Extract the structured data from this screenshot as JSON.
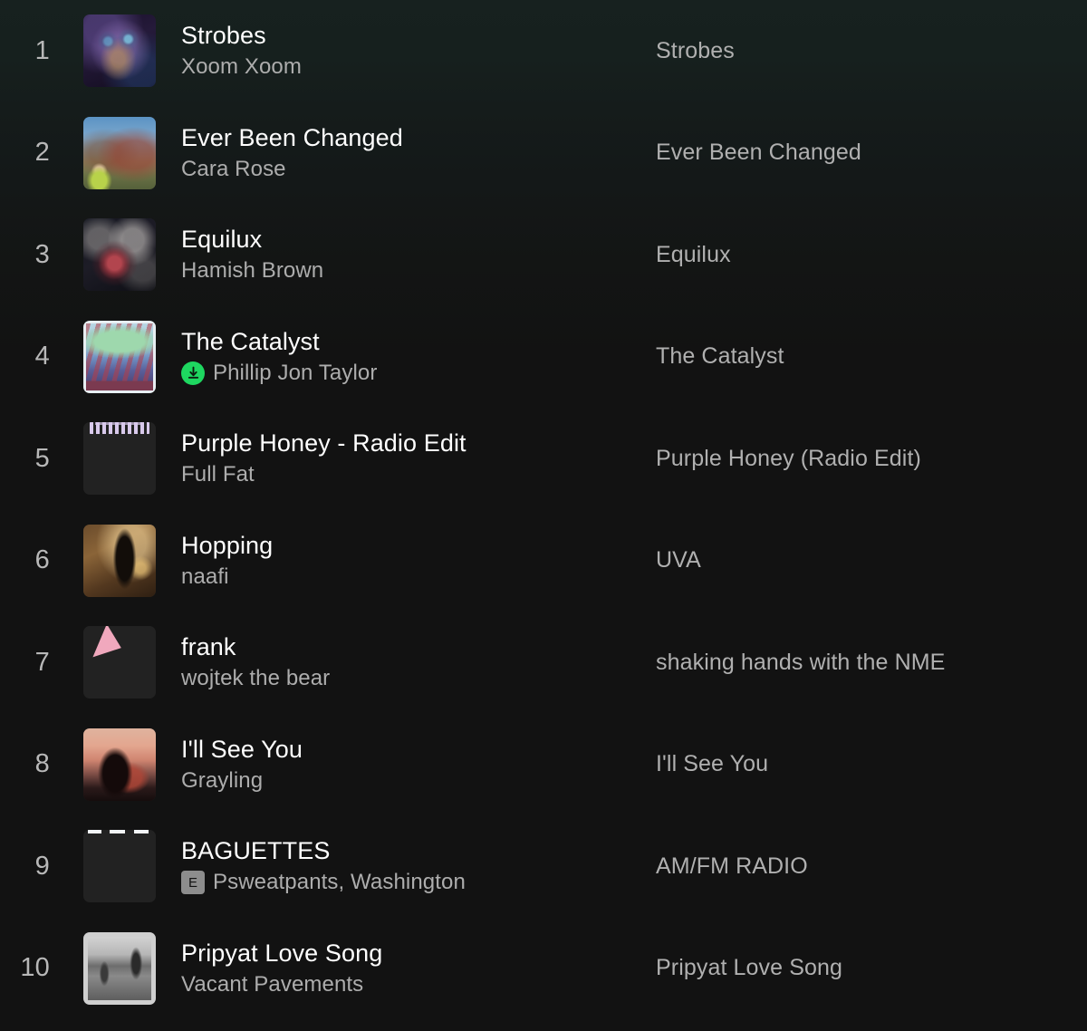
{
  "theme": {
    "background": "#121212",
    "background_top_tint": "#17211f",
    "title_color": "#ffffff",
    "artist_color": "#adadad",
    "album_color": "#b0b0b0",
    "rank_color": "#b8b8b8",
    "download_badge_color": "#1ed760",
    "explicit_badge_color": "#8d8d8d"
  },
  "tracks": [
    {
      "rank": "1",
      "title": "Strobes",
      "artist": "Xoom Xoom",
      "album": "Strobes",
      "artwork_name": "strobes-album-art",
      "downloaded": false,
      "explicit": false
    },
    {
      "rank": "2",
      "title": "Ever Been Changed",
      "artist": "Cara Rose",
      "album": "Ever Been Changed",
      "artwork_name": "ever-been-changed-album-art",
      "downloaded": false,
      "explicit": false
    },
    {
      "rank": "3",
      "title": "Equilux",
      "artist": "Hamish Brown",
      "album": "Equilux",
      "artwork_name": "equilux-album-art",
      "downloaded": false,
      "explicit": false
    },
    {
      "rank": "4",
      "title": "The Catalyst",
      "artist": "Phillip Jon Taylor",
      "album": "The Catalyst",
      "artwork_name": "the-catalyst-album-art",
      "downloaded": true,
      "explicit": false
    },
    {
      "rank": "5",
      "title": "Purple Honey - Radio Edit",
      "artist": "Full Fat",
      "album": "Purple Honey (Radio Edit)",
      "artwork_name": "purple-honey-album-art",
      "downloaded": false,
      "explicit": false
    },
    {
      "rank": "6",
      "title": "Hopping",
      "artist": "naafi",
      "album": "UVA",
      "artwork_name": "hopping-album-art",
      "downloaded": false,
      "explicit": false
    },
    {
      "rank": "7",
      "title": "frank",
      "artist": "wojtek the bear",
      "album": "shaking hands with the NME",
      "artwork_name": "frank-album-art",
      "downloaded": false,
      "explicit": false
    },
    {
      "rank": "8",
      "title": "I'll See You",
      "artist": "Grayling",
      "album": "I'll See You",
      "artwork_name": "ill-see-you-album-art",
      "downloaded": false,
      "explicit": false
    },
    {
      "rank": "9",
      "title": "BAGUETTES",
      "artist": "Psweatpants, Washington",
      "album": "AM/FM RADIO",
      "artwork_name": "baguettes-album-art",
      "downloaded": false,
      "explicit": true,
      "explicit_label": "E"
    },
    {
      "rank": "10",
      "title": "Pripyat Love Song",
      "artist": "Vacant Pavements",
      "album": "Pripyat Love Song",
      "artwork_name": "pripyat-love-song-album-art",
      "downloaded": false,
      "explicit": false
    }
  ]
}
